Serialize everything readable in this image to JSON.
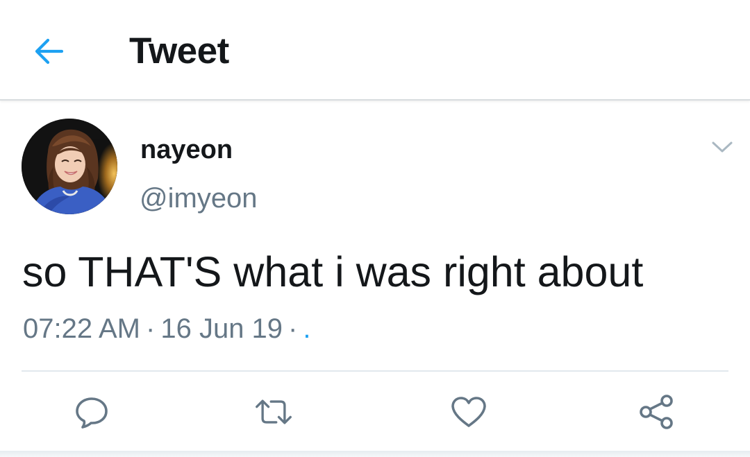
{
  "header": {
    "title": "Tweet",
    "back_icon": "arrow-left-icon"
  },
  "tweet": {
    "display_name": "nayeon",
    "handle": "@imyeon",
    "text": "so THAT'S what i was right about",
    "time": "07:22 AM",
    "date": "16 Jun 19",
    "separator": "·",
    "client": "."
  },
  "actions": [
    {
      "name": "reply",
      "icon": "speech-bubble-icon"
    },
    {
      "name": "retweet",
      "icon": "retweet-arrows-icon"
    },
    {
      "name": "like",
      "icon": "heart-icon"
    },
    {
      "name": "share",
      "icon": "share-icon"
    }
  ],
  "colors": {
    "accent": "#1da1f2",
    "text_primary": "#14171a",
    "text_secondary": "#657786",
    "divider": "#e1e8ed"
  }
}
